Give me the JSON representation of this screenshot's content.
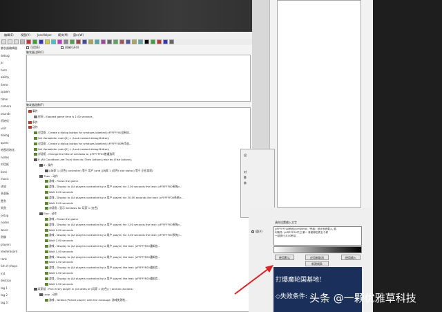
{
  "menubar": [
    "编辑(E)",
    "视图(V)",
    "JassHelper",
    "模块(M)",
    "窗口(W)"
  ],
  "editor": {
    "checks": [
      "可用(E)",
      "初始打开(I)"
    ],
    "comment_label": "触发器注释(C)",
    "func_label": "触发器函数(F)",
    "tree": [
      {
        "d": 0,
        "c": "#c0392b",
        "t": "事件"
      },
      {
        "d": 1,
        "c": "#777",
        "t": "时间 - Elapsed game time is 1.00 seconds"
      },
      {
        "d": 0,
        "c": "#c0392b",
        "t": "条件"
      },
      {
        "d": 0,
        "c": "#c0392b",
        "t": "动作"
      },
      {
        "d": 1,
        "c": "#5a8a2a",
        "t": "对话框 - Create a dialog button for windows labelled |cFFFFFF00没有执..."
      },
      {
        "d": 1,
        "c": "#5a8a2a",
        "t": "Set Variablefor main[1] = (Last created dialog Button)"
      },
      {
        "d": 1,
        "c": "#5a8a2a",
        "t": "对话框 - Create a dialog button for windows labelled |cFFFFFF00有币益..."
      },
      {
        "d": 1,
        "c": "#5a8a2a",
        "t": "Set Variablefor main[2] = (Last created dialog Button)"
      },
      {
        "d": 1,
        "c": "#5a8a2a",
        "t": "对话框 - Change the title of windows to |cFFFFFF00普通选项"
      },
      {
        "d": 1,
        "c": "#555",
        "t": "If (All Conditions are True) then do (Then Actions) else do (Else Actions)"
      },
      {
        "d": 2,
        "c": "#555",
        "t": "If - 条件"
      },
      {
        "d": 3,
        "c": "#555",
        "t": "((玩家 1 (红色) controller) 等于 用户) and ((玩家 1 (红色) slot status) 等于 正在游戏)"
      },
      {
        "d": 2,
        "c": "#555",
        "t": "Then - 动作"
      },
      {
        "d": 3,
        "c": "#5a8a2a",
        "t": "游戏 - Pause the game"
      },
      {
        "d": 3,
        "c": "#5a8a2a",
        "t": "游戏 - Display to (All players controlled by a 用户 player) for 2.00 seconds the text: |cFFFFFF00系统|r..."
      },
      {
        "d": 3,
        "c": "#5a8a2a",
        "t": "Wait 2.00 seconds"
      },
      {
        "d": 3,
        "c": "#5a8a2a",
        "t": "游戏 - Display to (All players controlled by a 用户 player) for 30.00 seconds the text: |cFFFFFF00系统|r..."
      },
      {
        "d": 3,
        "c": "#5a8a2a",
        "t": "Wait 2.00 seconds"
      },
      {
        "d": 3,
        "c": "#5a8a2a",
        "t": "对话框 - 显示 windows for 玩家 1 (红色)"
      },
      {
        "d": 2,
        "c": "#555",
        "t": "Else - 动作"
      },
      {
        "d": 3,
        "c": "#5a8a2a",
        "t": "游戏 - Pause the game"
      },
      {
        "d": 3,
        "c": "#5a8a2a",
        "t": "游戏 - Display to (All players controlled by a 用户 player) for 2.00 seconds the text: |cFFFFFF00系统|r..."
      },
      {
        "d": 3,
        "c": "#5a8a2a",
        "t": "Wait 2.00 seconds"
      },
      {
        "d": 3,
        "c": "#5a8a2a",
        "t": "游戏 - Display to (All players controlled by a 用户 player) for 3.00 seconds the text: |cFFFFFF00系统|r..."
      },
      {
        "d": 3,
        "c": "#5a8a2a",
        "t": "Wait 2.00 seconds"
      },
      {
        "d": 3,
        "c": "#5a8a2a",
        "t": "游戏 - Display to (All players controlled by a 用户 player) the text: |cFFFFFF00通知信..."
      },
      {
        "d": 3,
        "c": "#5a8a2a",
        "t": "Wait 1.00 seconds"
      },
      {
        "d": 3,
        "c": "#5a8a2a",
        "t": "游戏 - Display to (All players controlled by a 用户 player) the text: |cFFFFFF00通知信..."
      },
      {
        "d": 3,
        "c": "#5a8a2a",
        "t": "Wait 1.00 seconds"
      },
      {
        "d": 3,
        "c": "#5a8a2a",
        "t": "游戏 - Display to (All players controlled by a 用户 player) the text: |cFFFFFF00通知信..."
      },
      {
        "d": 3,
        "c": "#5a8a2a",
        "t": "Wait 1.00 seconds"
      },
      {
        "d": 3,
        "c": "#5a8a2a",
        "t": "游戏 - Display to (All players controlled by a 用户 player) the text: |cFFFFFF00通知信..."
      },
      {
        "d": 3,
        "c": "#5a8a2a",
        "t": "Wait 1.00 seconds"
      },
      {
        "d": 1,
        "c": "#555",
        "t": "玩家组 - Pick every player in (All allies of (玩家 1 (红色)) ) and do (Actions)"
      },
      {
        "d": 2,
        "c": "#555",
        "t": "Loop - 动作"
      },
      {
        "d": 3,
        "c": "#5a8a2a",
        "t": "游戏 - Defeat (Picked player) with the message: 游戏失败啦..."
      }
    ]
  },
  "leftpane": [
    "触发器编辑器",
    "debug",
    "ai",
    "hero",
    "ability",
    "items",
    "spawn",
    "timer",
    "camera",
    "sounds",
    "初始化",
    "unit",
    "dialog",
    "quest",
    "地图初始化",
    "nodes",
    "对话框",
    "boss",
    "music",
    "进攻",
    "多面板",
    "胜利",
    "失败",
    "setup",
    "nodes",
    "wave",
    "防御",
    "players",
    "leaderboard",
    "rank",
    "list of shops",
    "init",
    "destroy",
    "lag 1",
    "lag 2",
    "lag 3"
  ],
  "dialog_b": [
    "设",
    "对",
    "胜",
    "参"
  ],
  "panel_c": {
    "title": "请你设置输入文字",
    "radio_label": "值(A)",
    "text_lines": [
      "|cFFFFFF00系统|r|cff40ff40『杀敌』统计系统载入, 胜",
      "利条件: |cffFFFF00守卫 第一 条能够击败五个积",
      "一起统计 8.00秒后"
    ],
    "buttons": [
      "使用默认",
      "应用新取消",
      "使用输入"
    ],
    "button_wide": "新建线条",
    "preview_line1": "打爆魔轮国基地!",
    "preview_line2": "◇失败条件:"
  },
  "watermark": "头条 @一颗优雅草科技"
}
